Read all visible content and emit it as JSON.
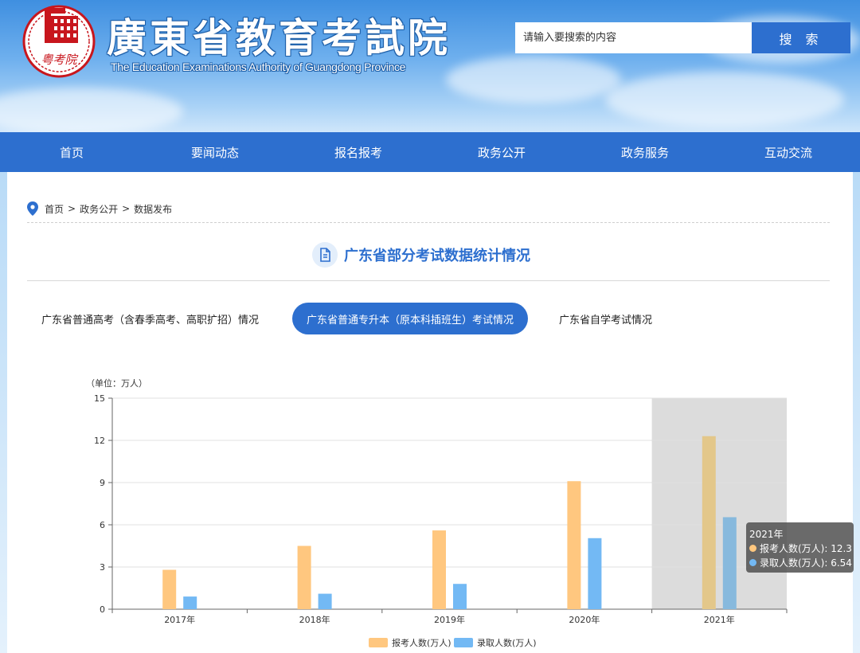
{
  "header": {
    "title": "廣東省教育考試院",
    "subtitle": "The Education Examinations Authority of Guangdong Province",
    "seal_text": "粤考院",
    "search_placeholder": "请输入要搜索的内容",
    "search_button": "搜 索"
  },
  "nav": {
    "items": [
      "首页",
      "要闻动态",
      "报名报考",
      "政务公开",
      "政务服务",
      "互动交流"
    ]
  },
  "breadcrumb": {
    "icon": "location-pin-icon",
    "items": [
      "首页",
      ">",
      "政务公开",
      ">",
      "数据发布"
    ]
  },
  "section": {
    "title": "广东省部分考试数据统计情况",
    "icon": "document-icon"
  },
  "tabs": [
    {
      "label": "广东省普通高考（含春季高考、高职扩招）情况",
      "active": false
    },
    {
      "label": "广东省普通专升本（原本科插班生）考试情况",
      "active": true
    },
    {
      "label": "广东省自学考试情况",
      "active": false
    }
  ],
  "colors": {
    "primary": "#2d6fcf",
    "applicants": "#ffc77f",
    "admitted": "#73b9f4",
    "highlight": "#dcdcdc"
  },
  "chart_data": {
    "type": "bar",
    "unit_label": "（单位：万人）",
    "categories": [
      "2017年",
      "2018年",
      "2019年",
      "2020年",
      "2021年"
    ],
    "series": [
      {
        "name": "报考人数(万人)",
        "values": [
          2.8,
          4.5,
          5.6,
          9.1,
          12.3
        ]
      },
      {
        "name": "录取人数(万人)",
        "values": [
          0.9,
          1.1,
          1.8,
          5.05,
          6.54
        ]
      }
    ],
    "ylim": [
      0,
      15
    ],
    "yticks": [
      0,
      3,
      6,
      9,
      12,
      15
    ],
    "highlight_category": "2021年",
    "legend_position": "bottom",
    "tooltip": {
      "title": "2021年",
      "rows": [
        "报考人数(万人): 12.3",
        "录取人数(万人): 6.54"
      ]
    }
  }
}
